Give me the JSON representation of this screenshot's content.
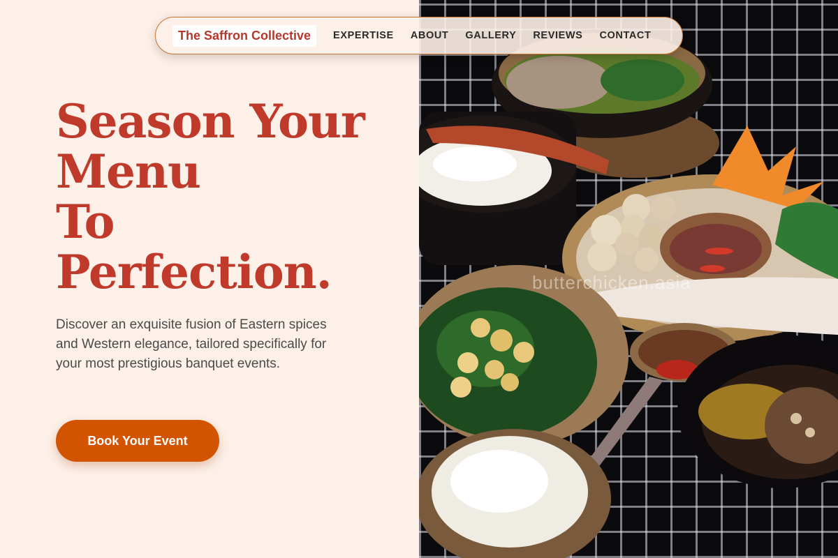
{
  "brand": "The Saffron Collective",
  "nav": {
    "items": [
      "EXPERTISE",
      "ABOUT",
      "GALLERY",
      "REVIEWS",
      "CONTACT"
    ]
  },
  "hero": {
    "title_lines": [
      "Season Your",
      "Menu",
      "To",
      "Perfection."
    ],
    "description": "Discover an exquisite fusion of Eastern spices and Western elegance, tailored specifically for your most prestigious banquet events.",
    "cta_label": "Book Your Event"
  },
  "image": {
    "watermark": "butterchicken.asia",
    "subject": "food-spread-photo"
  },
  "colors": {
    "background": "#fdf0e8",
    "title": "#bf3a2b",
    "accent": "#d35400",
    "nav_border": "#c8742e"
  }
}
